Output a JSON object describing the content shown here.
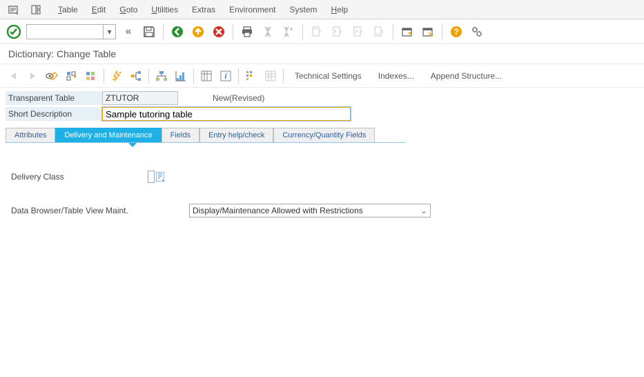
{
  "menu": {
    "table": "Table",
    "edit": "Edit",
    "goto": "Goto",
    "utilities": "Utilities",
    "extras": "Extras",
    "environment": "Environment",
    "system": "System",
    "help": "Help"
  },
  "screen_title": "Dictionary: Change Table",
  "toolbar2": {
    "tech_settings": "Technical Settings",
    "indexes": "Indexes...",
    "append": "Append Structure..."
  },
  "form": {
    "transp_table_label": "Transparent Table",
    "transp_table_value": "ZTUTOR",
    "status": "New(Revised)",
    "short_desc_label": "Short Description",
    "short_desc_value": "Sample tutoring table"
  },
  "tabs": {
    "attributes": "Attributes",
    "delivery": "Delivery and Maintenance",
    "fields": "Fields",
    "entry_help": "Entry help/check",
    "currency": "Currency/Quantity Fields"
  },
  "content": {
    "delivery_class_label": "Delivery Class",
    "delivery_class_value": "",
    "data_browser_label": "Data Browser/Table View Maint.",
    "data_browser_value": "Display/Maintenance Allowed with Restrictions"
  }
}
